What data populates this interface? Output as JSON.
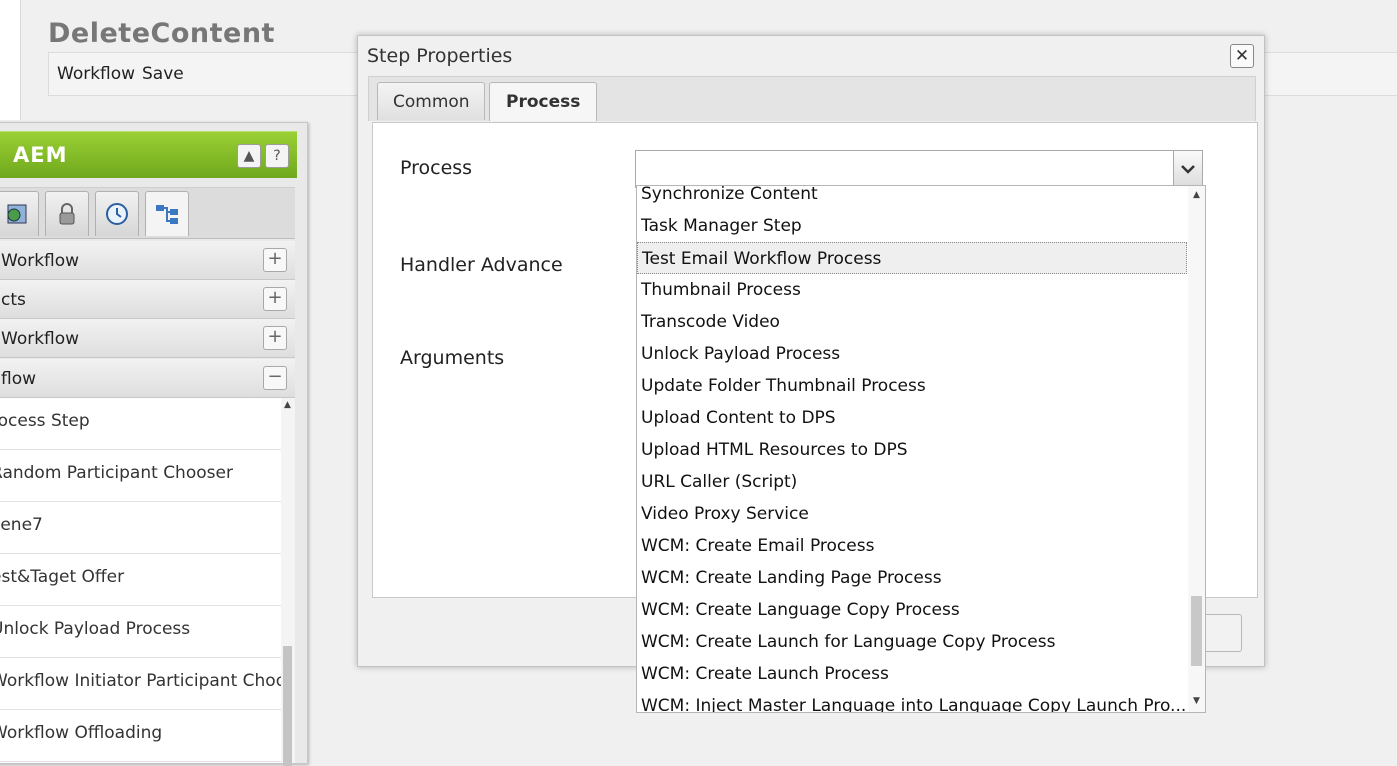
{
  "page": {
    "title": "DeleteContent",
    "toolbar": {
      "workflow_label": "Workflow",
      "save_label": "Save"
    }
  },
  "sidekick": {
    "title": "AEM",
    "header_buttons": [
      "▲",
      "?"
    ],
    "tabs": [
      "page-icon",
      "lock-icon",
      "clock-icon",
      "workflow-icon"
    ],
    "groups": [
      {
        "label": "Workflow",
        "toggle": "+"
      },
      {
        "label": "cts",
        "toggle": "+"
      },
      {
        "label": " Workflow",
        "toggle": "+"
      },
      {
        "label": "flow",
        "toggle": "−"
      }
    ],
    "items": [
      "rocess Step",
      "Random Participant Chooser",
      "cene7",
      "est&Taget Offer",
      "Unlock Payload Process",
      "Workflow Initiator Participant Choo",
      "Workflow Offloading"
    ]
  },
  "dialog": {
    "title": "Step Properties",
    "close_label": "✕",
    "tabs": [
      {
        "label": "Common",
        "active": false
      },
      {
        "label": "Process",
        "active": true
      }
    ],
    "fields": {
      "process_label": "Process",
      "handler_label": "Handler Advance",
      "arguments_label": "Arguments",
      "process_value": ""
    }
  },
  "dropdown": {
    "items": [
      "Synchronize Content",
      "Task Manager Step",
      "Test Email Workflow Process",
      "Thumbnail Process",
      "Transcode Video",
      "Unlock Payload Process",
      "Update Folder Thumbnail Process",
      "Upload Content to DPS",
      "Upload HTML Resources to DPS",
      "URL Caller (Script)",
      "Video Proxy Service",
      "WCM: Create Email Process",
      "WCM: Create Landing Page Process",
      "WCM: Create Language Copy Process",
      "WCM: Create Launch for Language Copy Process",
      "WCM: Create Launch Process",
      "WCM: Inject Master Language into Language Copy Launch Pro..."
    ],
    "selected_index": 2
  },
  "colors": {
    "accent_green": "#7fb92a",
    "background": "#f0f0f0"
  }
}
